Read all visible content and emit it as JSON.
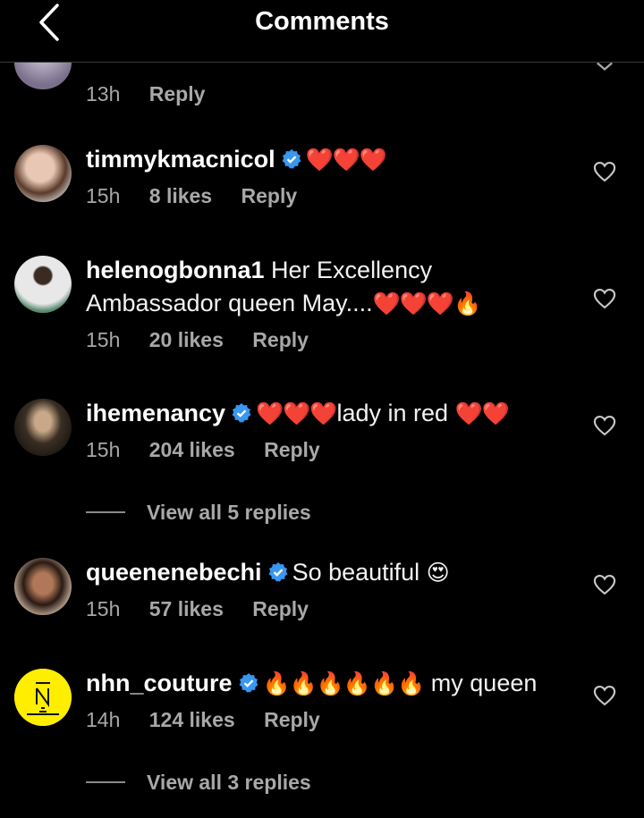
{
  "header": {
    "title": "Comments"
  },
  "top_partial": {
    "time": "13h",
    "reply": "Reply"
  },
  "comments": [
    {
      "username": "timmykmacnicol",
      "verified": true,
      "text_before": "",
      "emoji": "❤️❤️❤️",
      "text_after": "",
      "time": "15h",
      "likes": "8 likes",
      "reply": "Reply"
    },
    {
      "username": "helenogbonna1",
      "verified": false,
      "text_before": "Her Excellency Ambassador queen May....",
      "emoji": "❤️❤️❤️🔥",
      "text_after": "",
      "time": "15h",
      "likes": "20 likes",
      "reply": "Reply"
    },
    {
      "username": "ihemenancy",
      "verified": true,
      "text_before": "",
      "emoji": "❤️❤️❤️",
      "text_after": "lady in red ",
      "emoji2": "❤️❤️",
      "time": "15h",
      "likes": "204 likes",
      "reply": "Reply"
    },
    {
      "username": "queenenebechi",
      "verified": true,
      "text_before": "So beautiful ",
      "emoji": "😍",
      "text_after": "",
      "time": "15h",
      "likes": "57 likes",
      "reply": "Reply"
    },
    {
      "username": "nhn_couture",
      "verified": true,
      "text_before": "",
      "emoji": "🔥🔥🔥🔥🔥🔥",
      "text_after": " my queen",
      "time": "14h",
      "likes": "124 likes",
      "reply": "Reply"
    }
  ],
  "view_replies": [
    "View all 5 replies",
    "View all 3 replies"
  ],
  "colors": {
    "verified": "#3897f0",
    "muted": "#a8a8a8",
    "background": "#000000"
  }
}
